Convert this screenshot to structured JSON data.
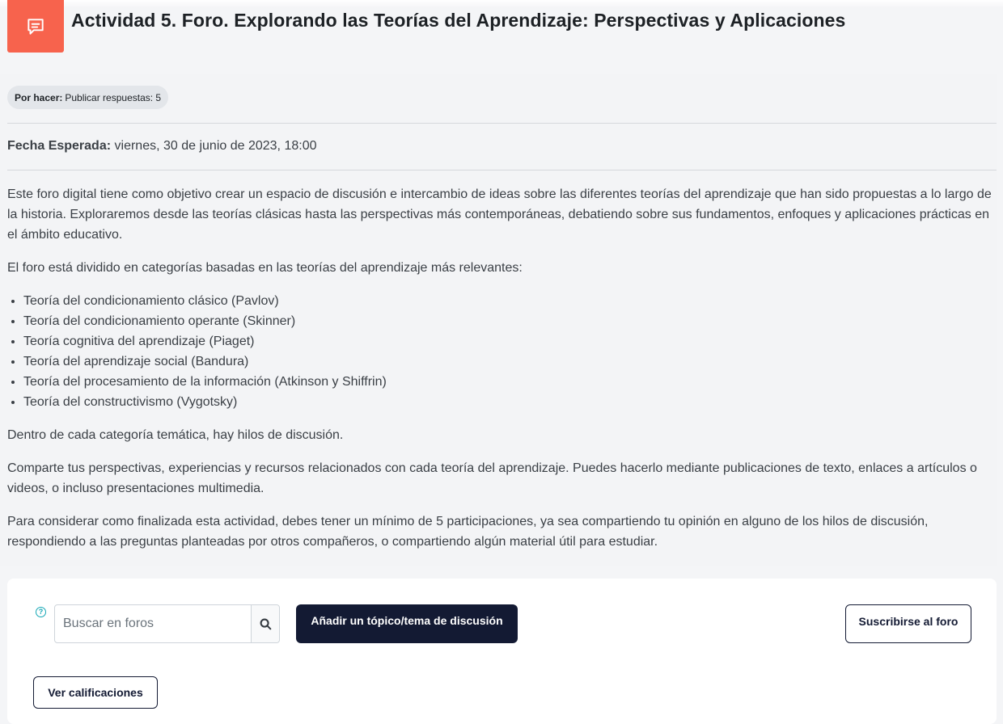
{
  "header": {
    "title": "Actividad 5. Foro. Explorando las Teorías del Aprendizaje: Perspectivas y Aplicaciones",
    "icon": "forum-icon",
    "icon_color": "#f7634d"
  },
  "completion": {
    "label": "Por hacer:",
    "text": "Publicar respuestas: 5"
  },
  "due": {
    "label": "Fecha Esperada:",
    "value": "viernes, 30 de junio de 2023, 18:00"
  },
  "description": {
    "intro": "Este foro digital tiene como objetivo crear un espacio de discusión e intercambio de ideas sobre las diferentes teorías del aprendizaje que han sido propuestas a lo largo de la historia. Exploraremos desde las teorías clásicas hasta las perspectivas más contemporáneas, debatiendo sobre sus fundamentos, enfoques y aplicaciones prácticas en el ámbito educativo.",
    "categories_intro": "El foro está dividido en categorías basadas en las teorías del aprendizaje más relevantes:",
    "categories": [
      "Teoría del condicionamiento clásico (Pavlov)",
      "Teoría del condicionamiento operante (Skinner)",
      "Teoría cognitiva del aprendizaje (Piaget)",
      "Teoría del aprendizaje social (Bandura)",
      "Teoría del procesamiento de la información (Atkinson y Shiffrin)",
      "Teoría del constructivismo (Vygotsky)"
    ],
    "threads_note": "Dentro de cada categoría temática, hay hilos de discusión.",
    "share_note": "Comparte tus perspectivas, experiencias y recursos relacionados con cada teoría del aprendizaje. Puedes hacerlo mediante publicaciones de texto, enlaces a artículos o videos, o incluso presentaciones multimedia.",
    "completion_note": "Para considerar como finalizada esta actividad, debes tener un mínimo de 5 participaciones, ya sea compartiendo tu opinión en alguno de los hilos de discusión, respondiendo a las preguntas planteadas por otros compañeros, o compartiendo algún material útil para estudiar."
  },
  "actions": {
    "help_icon": "question-circle-icon",
    "search_placeholder": "Buscar en foros",
    "search_icon": "search-icon",
    "add_topic_label": "Añadir un tópico/tema de discusión",
    "subscribe_label": "Suscribirse al foro",
    "grades_label": "Ver calificaciones",
    "primary_color": "#131a33"
  }
}
